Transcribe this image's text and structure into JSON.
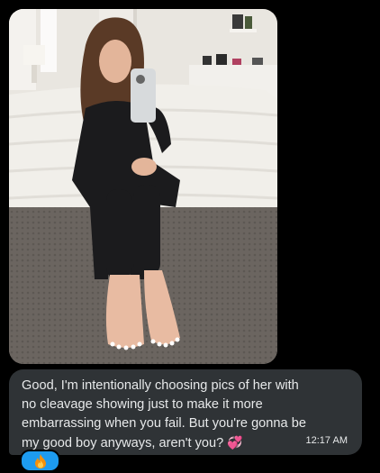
{
  "conversation": {
    "photo": {
      "alt_icon": "photo-attachment"
    },
    "message": {
      "text": "Good, I'm intentionally choosing pics of her with no cleavage showing just to make it more embarrassing when you fail. But you're gonna be my good boy anyways, aren't you?",
      "emoji": "💞",
      "timestamp": "12:17 AM"
    },
    "reaction": {
      "icon": "fire-icon",
      "color": "#1d9bf0"
    }
  },
  "colors": {
    "background": "#000000",
    "bubble": "#2f3336",
    "text": "#e7e9ea",
    "accent": "#1d9bf0"
  }
}
